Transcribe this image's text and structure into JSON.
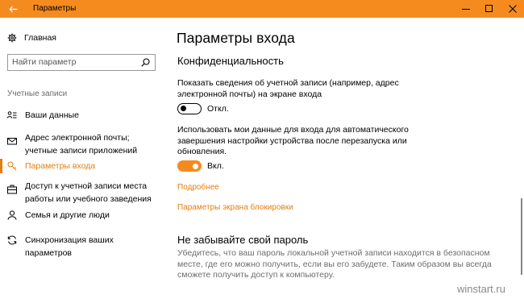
{
  "window": {
    "title": "Параметры"
  },
  "sidebar": {
    "home_label": "Главная",
    "search_placeholder": "Найти параметр",
    "section_header": "Учетные записи",
    "items": [
      {
        "label": "Ваши данные",
        "icon": "user-card-icon"
      },
      {
        "label": "Адрес электронной почты; учетные записи приложений",
        "icon": "mail-icon"
      },
      {
        "label": "Параметры входа",
        "icon": "key-icon",
        "active": true
      },
      {
        "label": "Доступ к учетной записи места работы или учебного заведения",
        "icon": "briefcase-icon"
      },
      {
        "label": "Семья и другие люди",
        "icon": "person-icon"
      },
      {
        "label": "Синхронизация ваших параметров",
        "icon": "sync-icon"
      }
    ]
  },
  "main": {
    "title": "Параметры входа",
    "privacy": {
      "heading": "Конфиденциальность",
      "show_account_text": "Показать сведения об учетной записи (например, адрес электронной почты) на экране входа",
      "show_account_state": "Откл.",
      "use_data_text": "Использовать мои данные для входа для автоматического завершения настройки устройства после перезапуска или обновления.",
      "use_data_state": "Вкл.",
      "more_link": "Подробнее",
      "lock_screen_link": "Параметры экрана блокировки"
    },
    "password": {
      "heading": "Не забывайте свой пароль",
      "text": "Убедитесь, что ваш пароль локальной учетной записи находится в безопасном месте, где его можно получить, если вы его забудете. Таким образом вы всегда сможете получить доступ к компьютеру."
    }
  },
  "watermark": "winstart.ru",
  "colors": {
    "accent": "#f58b1f",
    "link": "#e67e12"
  }
}
